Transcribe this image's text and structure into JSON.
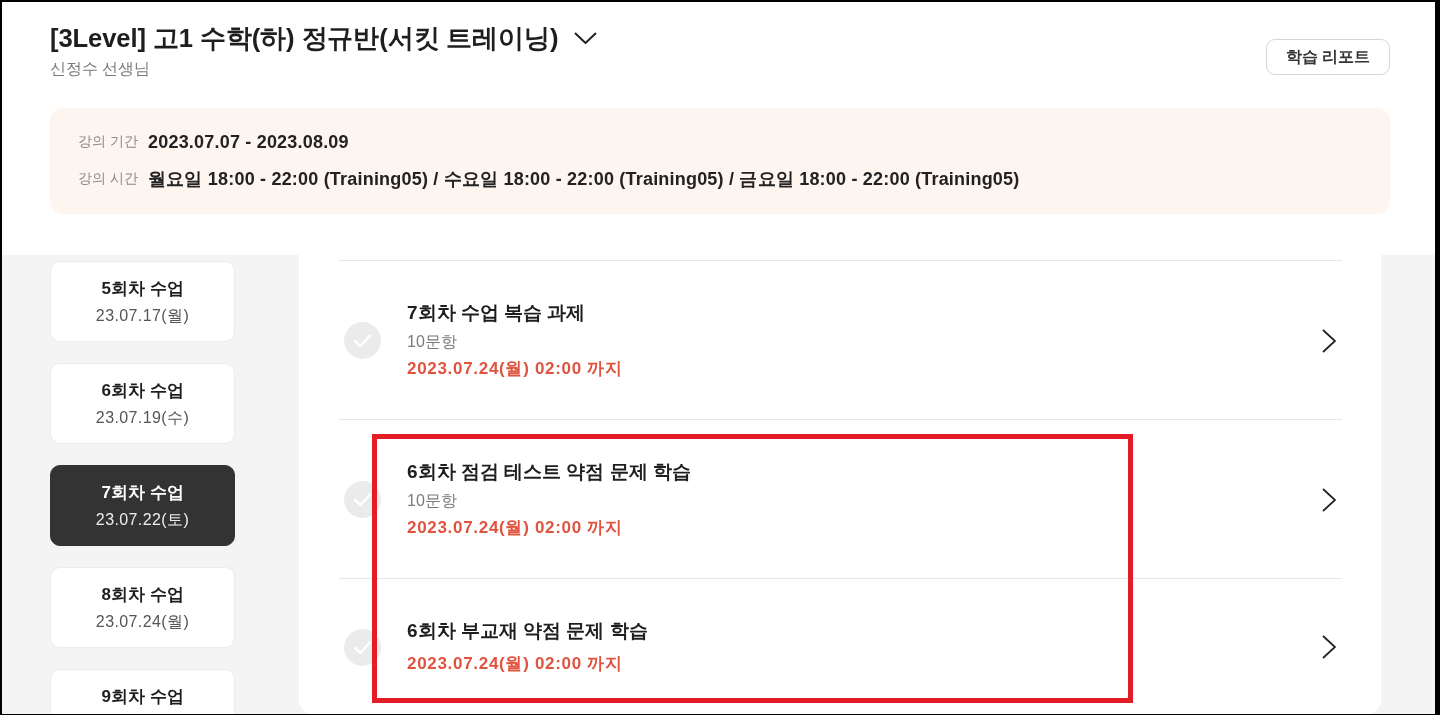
{
  "header": {
    "title": "[3Level] 고1 수학(하) 정규반(서킷 트레이닝)",
    "teacher": "신정수 선생님",
    "report_button": "학습 리포트"
  },
  "course_info": [
    {
      "label": "강의 기간",
      "value": "2023.07.07 - 2023.08.09"
    },
    {
      "label": "강의 시간",
      "value": "월요일 18:00 - 22:00 (Training05) / 수요일 18:00 - 22:00 (Training05) / 금요일 18:00 - 22:00 (Training05)"
    }
  ],
  "sessions": [
    {
      "title": "5회차 수업",
      "date": "23.07.17(월)",
      "selected": false
    },
    {
      "title": "6회차 수업",
      "date": "23.07.19(수)",
      "selected": false
    },
    {
      "title": "7회차 수업",
      "date": "23.07.22(토)",
      "selected": true
    },
    {
      "title": "8회차 수업",
      "date": "23.07.24(월)",
      "selected": false
    },
    {
      "title": "9회차 수업",
      "selected": false
    }
  ],
  "assignments": [
    {
      "title": "7회차 수업 복습 과제",
      "count": "10문항",
      "due": "2023.07.24(월) 02:00 까지",
      "highlighted": false
    },
    {
      "title": "6회차 점검 테스트 약점 문제 학습",
      "count": "10문항",
      "due": "2023.07.24(월) 02:00 까지",
      "highlighted": true
    },
    {
      "title": "6회차 부교재 약점 문제 학습",
      "due": "2023.07.24(월) 02:00 까지",
      "highlighted": true
    }
  ]
}
